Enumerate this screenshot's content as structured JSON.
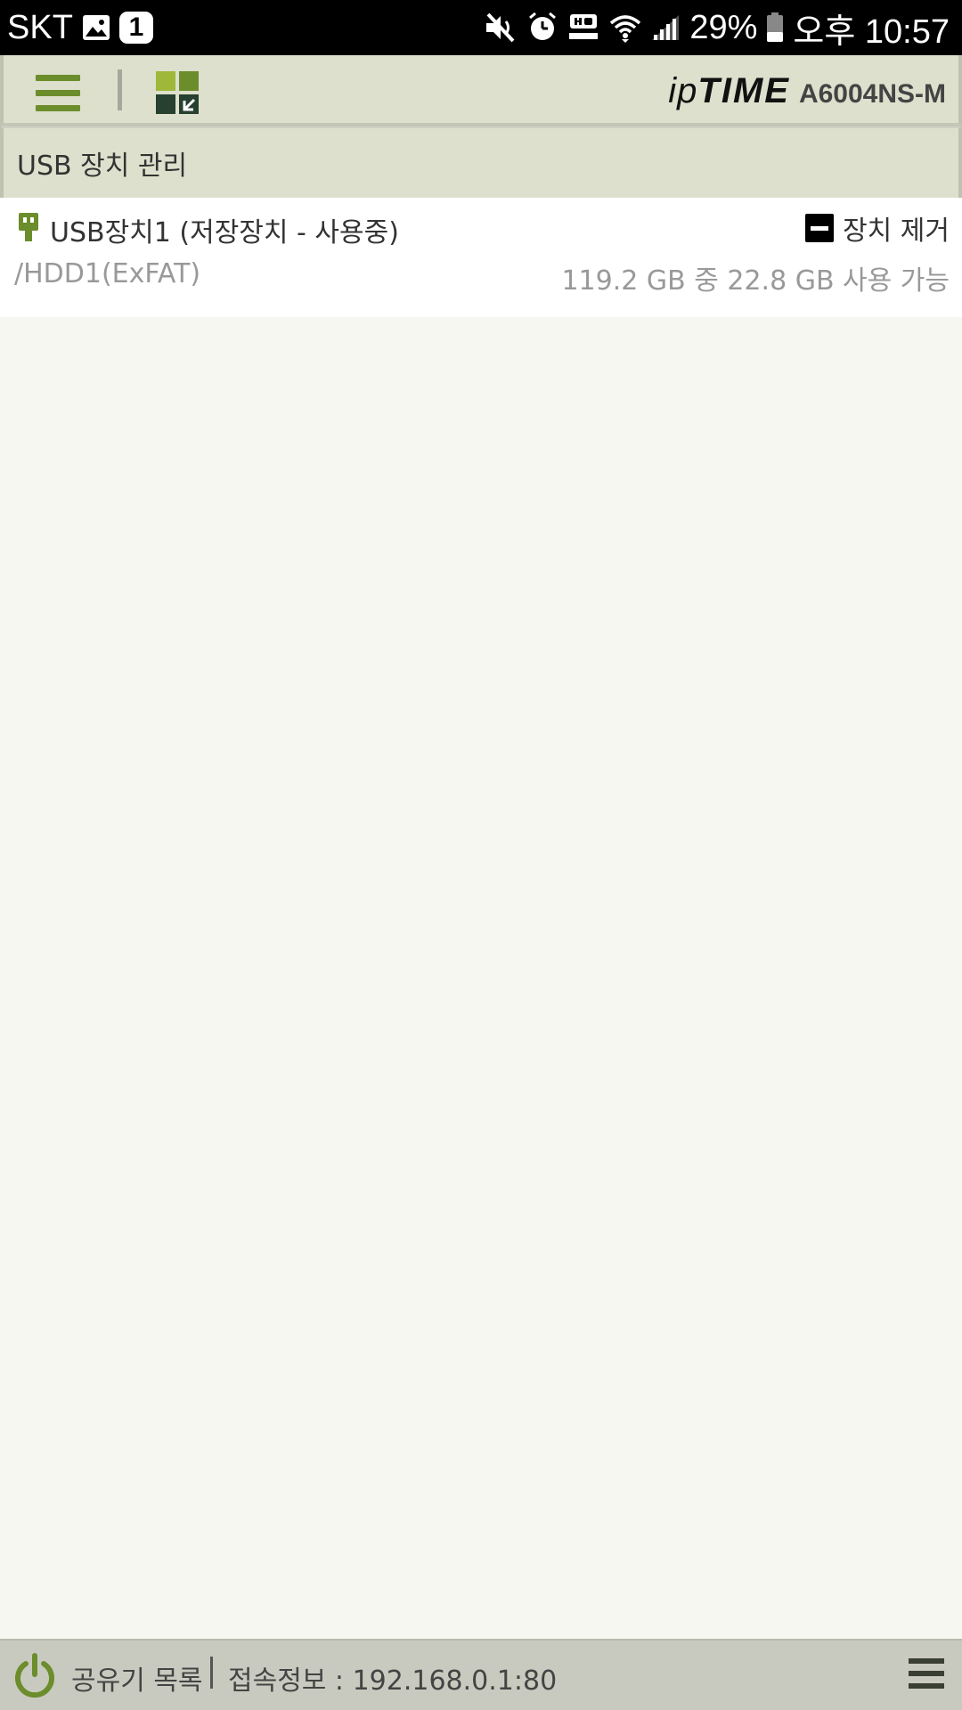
{
  "status_bar": {
    "carrier": "SKT",
    "notification_count": "1",
    "battery_percent": "29%",
    "time": "오후 10:57"
  },
  "header": {
    "brand_ip": "ip",
    "brand_time": "TIME",
    "model": "A6004NS-M",
    "colors": {
      "header_bg": "#dde0cc",
      "accent_green": "#6b8d2c"
    }
  },
  "section": {
    "title": "USB 장치 관리"
  },
  "device": {
    "name": "USB장치1  (저장장치 - 사용중)",
    "remove_label": "장치 제거",
    "path": "/HDD1(ExFAT)",
    "capacity": "119.2 GB 중 22.8 GB 사용 가능"
  },
  "footer": {
    "router_list": "공유기 목록",
    "connection_info": "접속정보 : 192.168.0.1:80"
  }
}
